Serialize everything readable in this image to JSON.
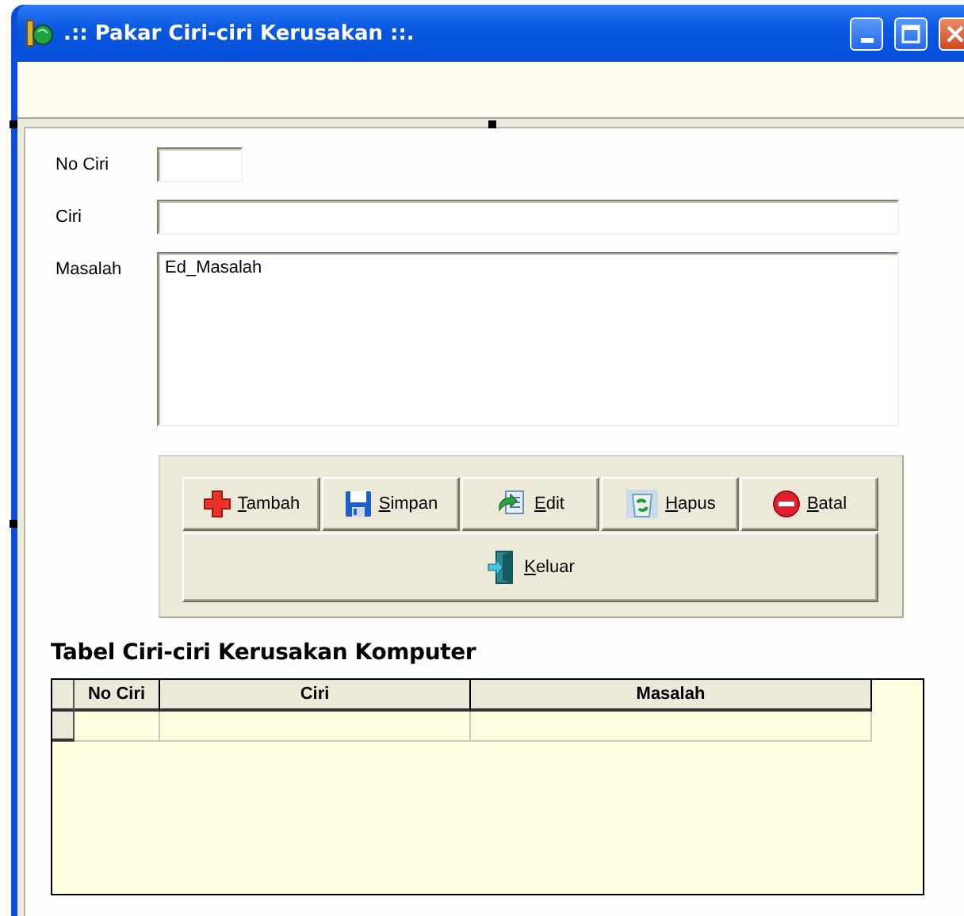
{
  "window": {
    "title": ".:: Pakar Ciri-ciri Kerusakan ::."
  },
  "fields": [
    {
      "kind": "short",
      "label": "No Ciri"
    },
    {
      "kind": "line",
      "label": "Ciri"
    },
    {
      "kind": "memo",
      "label": "Masalah",
      "value": "Ed_Masalah"
    }
  ],
  "buttons": [
    {
      "kind": "add",
      "label": "Tambah",
      "underline_first": true
    },
    {
      "kind": "save",
      "label": "Simpan",
      "underline_first": true
    },
    {
      "kind": "edit",
      "label": "Edit",
      "underline_first": true
    },
    {
      "kind": "delete",
      "label": "Hapus",
      "underline_first": true
    },
    {
      "kind": "cancel",
      "label": "Batal",
      "underline_first": true
    },
    {
      "kind": "exit",
      "label": "Keluar",
      "underline_first": true
    }
  ],
  "table": {
    "title": "Tabel Ciri-ciri Kerusakan Komputer",
    "columns": [
      "No Ciri",
      "Ciri",
      "Masalah"
    ],
    "empty_row": true
  }
}
